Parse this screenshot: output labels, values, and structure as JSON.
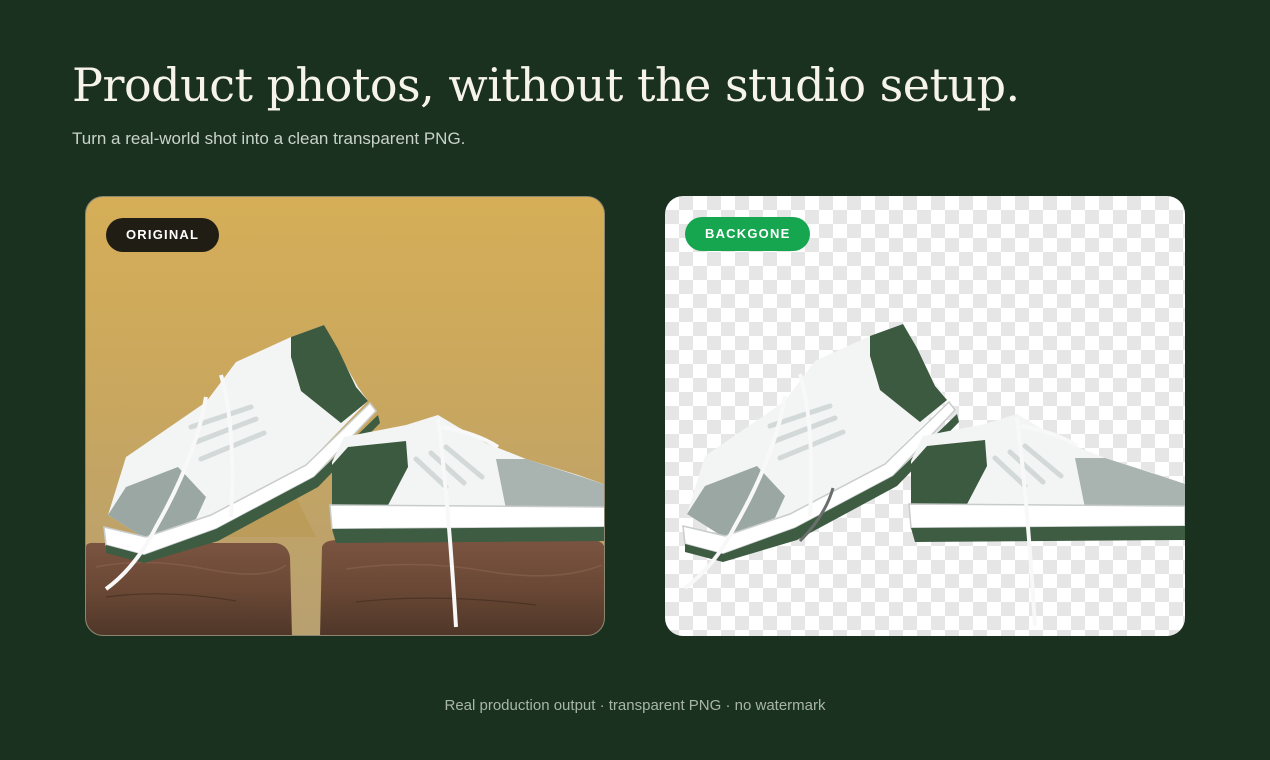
{
  "hero": {
    "headline": "Product photos, without the studio setup.",
    "subheadline": "Turn a real-world shot into a clean transparent PNG."
  },
  "panels": {
    "original": {
      "badge": "ORIGINAL"
    },
    "result": {
      "badge": "BACKGONE"
    }
  },
  "caption": "Real production output · transparent PNG · no watermark",
  "colors": {
    "page_background": "#1b3120",
    "badge_original": "#201d14",
    "badge_result": "#17a650",
    "shoe_accent": "#3c5a40",
    "wall": "#d0ac5c",
    "leather": "#6e4c38"
  }
}
